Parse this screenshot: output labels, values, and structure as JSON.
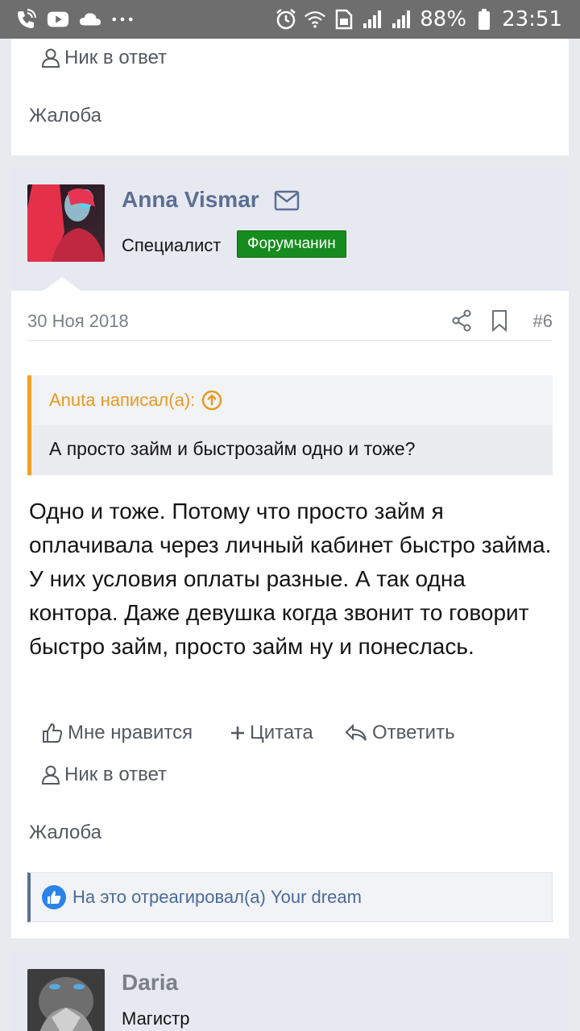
{
  "status_bar": {
    "battery": "88%",
    "time": "23:51"
  },
  "post_top": {
    "nick_reply": "Ник в ответ",
    "report": "Жалоба"
  },
  "post_main": {
    "author": "Anna Vismar",
    "user_title": "Специалист",
    "badge": "Форумчанин",
    "date": "30 Ноя 2018",
    "post_number": "#6",
    "quote": {
      "header": "Anuta написал(а):",
      "text": "А просто займ и быстрозайм одно и тоже?"
    },
    "text": "Одно и тоже. Потому что просто займ я оплачивала через личный кабинет быстро займа. У них условия оплаты разные. А так одна контора. Даже девушка когда звонит то говорит быстро займ, просто займ ну и понеслась.",
    "actions": {
      "like": "Мне нравится",
      "quote": "Цитата",
      "reply": "Ответить",
      "nick_reply": "Ник в ответ",
      "report": "Жалоба"
    },
    "reaction": "На это отреагировал(а) Your dream"
  },
  "post_next": {
    "author": "Daria",
    "user_title": "Магистр"
  },
  "colors": {
    "accent": "#5b6f93",
    "badge": "#158c1d",
    "quote_border": "#f0a025",
    "reaction_icon": "#2a83e8"
  }
}
